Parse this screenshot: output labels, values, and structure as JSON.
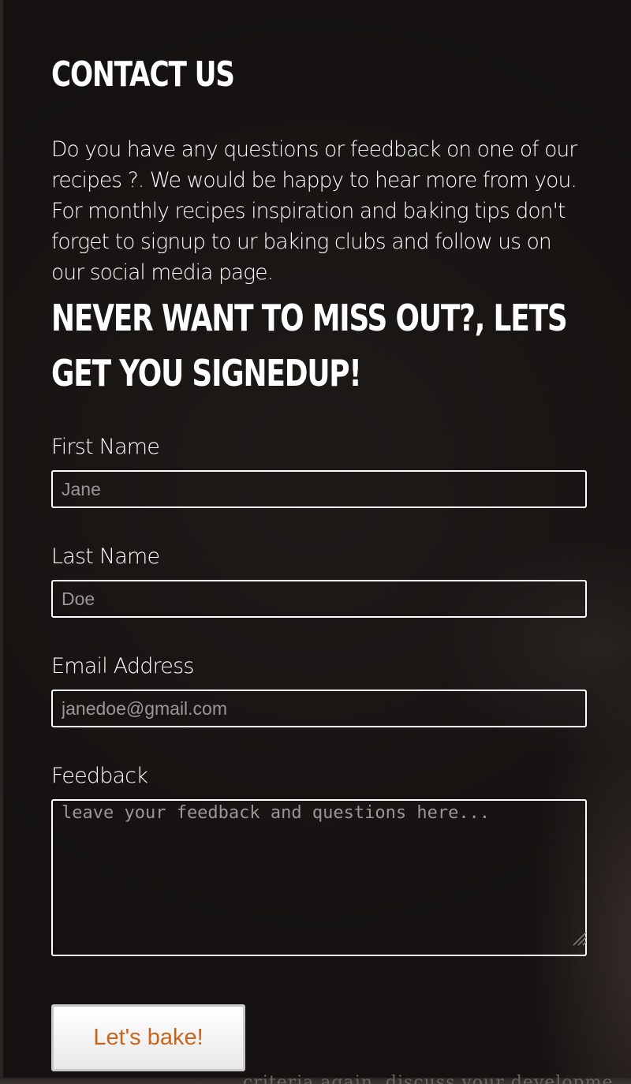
{
  "contact": {
    "title": "CONTACT US",
    "intro": "Do you have any questions or feedback on one of our recipes ?. We would be happy to hear more from you. For monthly recipes inspiration and baking tips don't forget to signup to ur baking clubs and follow us on our social media page."
  },
  "signup": {
    "title": "NEVER WANT TO MISS OUT?, LETS GET YOU SIGNEDUP!"
  },
  "form": {
    "first_name": {
      "label": "First Name",
      "placeholder": "Jane"
    },
    "last_name": {
      "label": "Last Name",
      "placeholder": "Doe"
    },
    "email": {
      "label": "Email Address",
      "placeholder": "janedoe@gmail.com"
    },
    "feedback": {
      "label": "Feedback",
      "placeholder": "leave your feedback and questions here..."
    },
    "submit_label": "Let's bake!"
  },
  "footer_fragment": "criteria again, discuss your developme",
  "colors": {
    "background": "#161312",
    "text": "#ffffff",
    "button_text": "#c8651d",
    "placeholder": "#9a9796"
  },
  "icons": {
    "resize_grip": "resize-grip-icon"
  }
}
